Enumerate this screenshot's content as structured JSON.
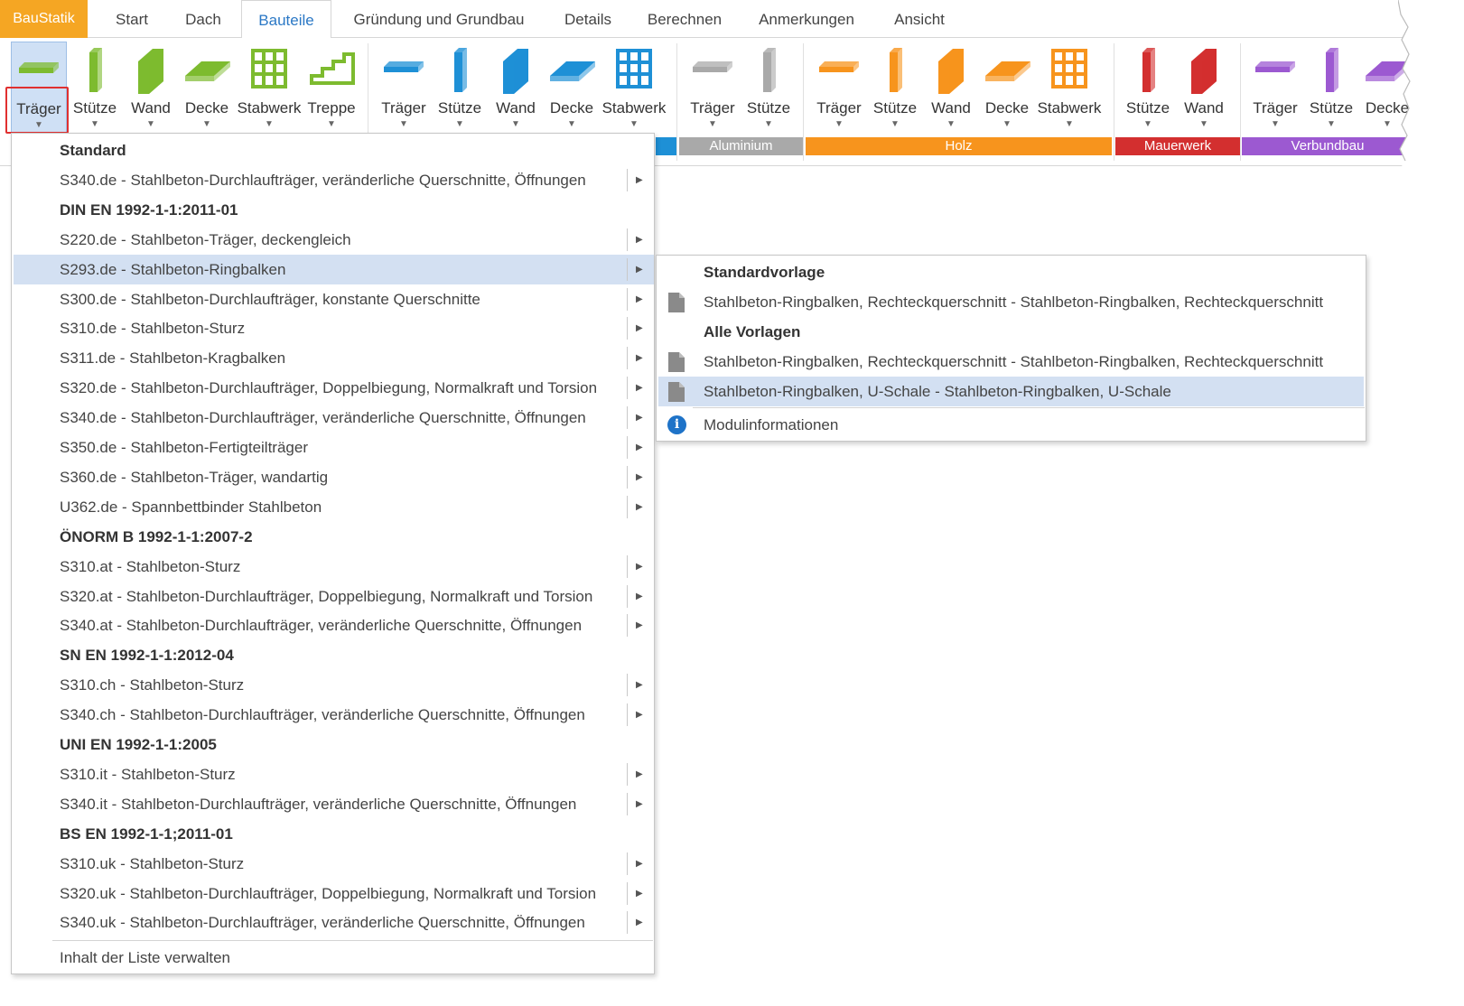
{
  "app": {
    "button_label": "BauStatik"
  },
  "tabs": [
    "Start",
    "Dach",
    "Bauteile",
    "Gründung und Grundbau",
    "Details",
    "Berechnen",
    "Anmerkungen",
    "Ansicht"
  ],
  "active_tab": "Bauteile",
  "ribbon": {
    "groups": [
      {
        "label": "",
        "color": "#7dbb2f",
        "buttons": [
          "Träger",
          "Stütze",
          "Wand",
          "Decke",
          "Stabwerk",
          "Treppe"
        ]
      },
      {
        "label": "",
        "color": "#1e90d6",
        "buttons": [
          "Träger",
          "Stütze",
          "Wand",
          "Decke",
          "Stabwerk"
        ]
      },
      {
        "label": "Aluminium",
        "color": "#a9a9a9",
        "buttons": [
          "Träger",
          "Stütze"
        ]
      },
      {
        "label": "Holz",
        "color": "#f7941d",
        "buttons": [
          "Träger",
          "Stütze",
          "Wand",
          "Decke",
          "Stabwerk"
        ]
      },
      {
        "label": "Mauerwerk",
        "color": "#d32f2f",
        "buttons": [
          "Stütze",
          "Wand"
        ]
      },
      {
        "label": "Verbundbau",
        "color": "#9c59d1",
        "buttons": [
          "Träger",
          "Stütze",
          "Decke"
        ]
      }
    ]
  },
  "menu": {
    "items": [
      {
        "type": "head",
        "label": "Standard"
      },
      {
        "type": "item",
        "label": "S340.de - Stahlbeton-Durchlaufträger, veränderliche Querschnitte, Öffnungen"
      },
      {
        "type": "head",
        "label": "DIN EN 1992-1-1:2011-01"
      },
      {
        "type": "item",
        "label": "S220.de - Stahlbeton-Träger, deckengleich"
      },
      {
        "type": "item",
        "label": "S293.de - Stahlbeton-Ringbalken",
        "highlighted": true
      },
      {
        "type": "item",
        "label": "S300.de - Stahlbeton-Durchlaufträger, konstante Querschnitte"
      },
      {
        "type": "item",
        "label": "S310.de - Stahlbeton-Sturz"
      },
      {
        "type": "item",
        "label": "S311.de - Stahlbeton-Kragbalken"
      },
      {
        "type": "item",
        "label": "S320.de - Stahlbeton-Durchlaufträger, Doppelbiegung, Normalkraft und Torsion"
      },
      {
        "type": "item",
        "label": "S340.de - Stahlbeton-Durchlaufträger, veränderliche Querschnitte, Öffnungen"
      },
      {
        "type": "item",
        "label": "S350.de - Stahlbeton-Fertigteilträger"
      },
      {
        "type": "item",
        "label": "S360.de - Stahlbeton-Träger, wandartig"
      },
      {
        "type": "item",
        "label": "U362.de - Spannbettbinder Stahlbeton"
      },
      {
        "type": "head",
        "label": "ÖNORM B 1992-1-1:2007-2"
      },
      {
        "type": "item",
        "label": "S310.at - Stahlbeton-Sturz"
      },
      {
        "type": "item",
        "label": "S320.at - Stahlbeton-Durchlaufträger, Doppelbiegung, Normalkraft und Torsion"
      },
      {
        "type": "item",
        "label": "S340.at - Stahlbeton-Durchlaufträger, veränderliche Querschnitte, Öffnungen"
      },
      {
        "type": "head",
        "label": "SN EN 1992-1-1:2012-04"
      },
      {
        "type": "item",
        "label": "S310.ch - Stahlbeton-Sturz"
      },
      {
        "type": "item",
        "label": "S340.ch - Stahlbeton-Durchlaufträger, veränderliche Querschnitte, Öffnungen"
      },
      {
        "type": "head",
        "label": "UNI EN 1992-1-1:2005"
      },
      {
        "type": "item",
        "label": "S310.it - Stahlbeton-Sturz"
      },
      {
        "type": "item",
        "label": "S340.it - Stahlbeton-Durchlaufträger, veränderliche Querschnitte, Öffnungen"
      },
      {
        "type": "head",
        "label": "BS EN 1992-1-1;2011-01"
      },
      {
        "type": "item",
        "label": "S310.uk - Stahlbeton-Sturz"
      },
      {
        "type": "item",
        "label": "S320.uk - Stahlbeton-Durchlaufträger, Doppelbiegung, Normalkraft und Torsion"
      },
      {
        "type": "item",
        "label": "S340.uk - Stahlbeton-Durchlaufträger, veränderliche Querschnitte, Öffnungen"
      }
    ],
    "footer_label": "Inhalt der Liste verwalten"
  },
  "submenu": {
    "head_standard": "Standardvorlage",
    "standard_item": "Stahlbeton-Ringbalken, Rechteckquerschnitt - Stahlbeton-Ringbalken, Rechteckquerschnitt",
    "head_all": "Alle Vorlagen",
    "all_items": [
      "Stahlbeton-Ringbalken, Rechteckquerschnitt - Stahlbeton-Ringbalken, Rechteckquerschnitt",
      "Stahlbeton-Ringbalken, U-Schale - Stahlbeton-Ringbalken, U-Schale"
    ],
    "highlighted_index": 1,
    "info_label": "Modulinformationen"
  }
}
